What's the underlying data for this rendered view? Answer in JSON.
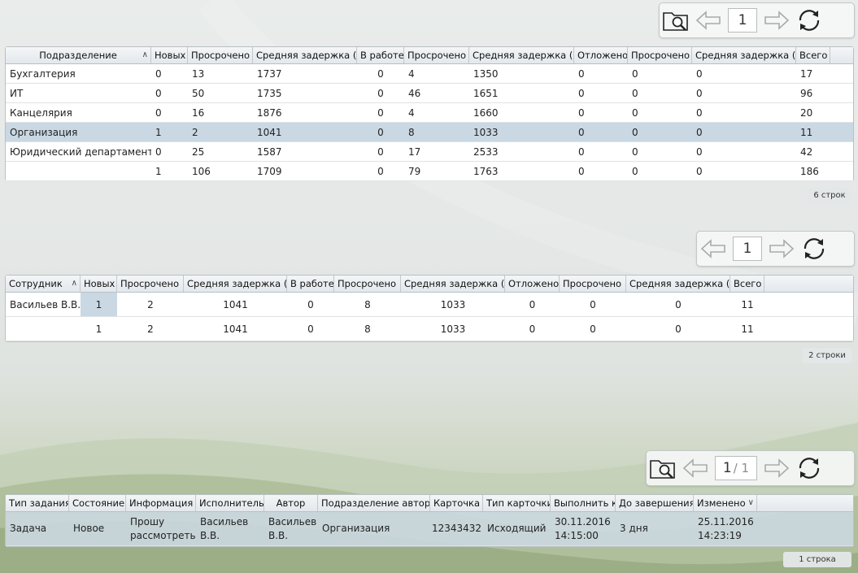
{
  "departments": {
    "columns": [
      "Подразделение",
      "Новых",
      "Просрочено",
      "Средняя задержка (ч)",
      "В работе",
      "Просрочено",
      "Средняя задержка (ч)",
      "Отложено",
      "Просрочено",
      "Средняя задержка (ч)",
      "Всего"
    ],
    "rows": [
      [
        "Бухгалтерия",
        "0",
        "13",
        "1737",
        "0",
        "4",
        "1350",
        "0",
        "0",
        "0",
        "17"
      ],
      [
        "ИТ",
        "0",
        "50",
        "1735",
        "0",
        "46",
        "1651",
        "0",
        "0",
        "0",
        "96"
      ],
      [
        "Канцелярия",
        "0",
        "16",
        "1876",
        "0",
        "4",
        "1660",
        "0",
        "0",
        "0",
        "20"
      ],
      [
        "Организация",
        "1",
        "2",
        "1041",
        "0",
        "8",
        "1033",
        "0",
        "0",
        "0",
        "11"
      ],
      [
        "Юридический департамент",
        "0",
        "25",
        "1587",
        "0",
        "17",
        "2533",
        "0",
        "0",
        "0",
        "42"
      ],
      [
        "",
        "1",
        "106",
        "1709",
        "0",
        "79",
        "1763",
        "0",
        "0",
        "0",
        "186"
      ]
    ],
    "selected_row": 3,
    "row_count": "6 строк",
    "page": "1"
  },
  "employees": {
    "columns": [
      "Сотрудник",
      "Новых",
      "Просрочено",
      "Средняя задержка (ч)",
      "В работе",
      "Просрочено",
      "Средняя задержка (ч)",
      "Отложено",
      "Просрочено",
      "Средняя задержка (ч)",
      "Всего"
    ],
    "rows": [
      [
        "Васильев В.В.",
        "1",
        "2",
        "1041",
        "0",
        "8",
        "1033",
        "0",
        "0",
        "0",
        "11"
      ],
      [
        "",
        "1",
        "2",
        "1041",
        "0",
        "8",
        "1033",
        "0",
        "0",
        "0",
        "11"
      ]
    ],
    "row_count": "2 строки",
    "page": "1"
  },
  "tasks": {
    "columns": [
      "Тип задания",
      "Состояние",
      "Информация",
      "Исполнитель",
      "Автор",
      "Подразделение автора",
      "Карточка",
      "Тип карточки",
      "Выполнить к",
      "До завершения",
      "Изменено"
    ],
    "rows": [
      [
        "Задача",
        "Новое",
        "Прошу рассмотреть",
        "Васильев В.В.",
        "Васильев В.В.",
        "Организация",
        "12343432",
        "Исходящий",
        "30.11.2016 14:15:00",
        "3 дня",
        "25.11.2016 14:23:19"
      ]
    ],
    "row_count": "1 строка",
    "page": "1",
    "page_total": "/ 1"
  },
  "icons": {
    "search_folder": "folder-search-icon",
    "prev": "arrow-left-icon",
    "next": "arrow-right-icon",
    "refresh": "refresh-icon"
  },
  "colors": {
    "selection": "#c9d8e3",
    "header": "#e3e8ec"
  }
}
